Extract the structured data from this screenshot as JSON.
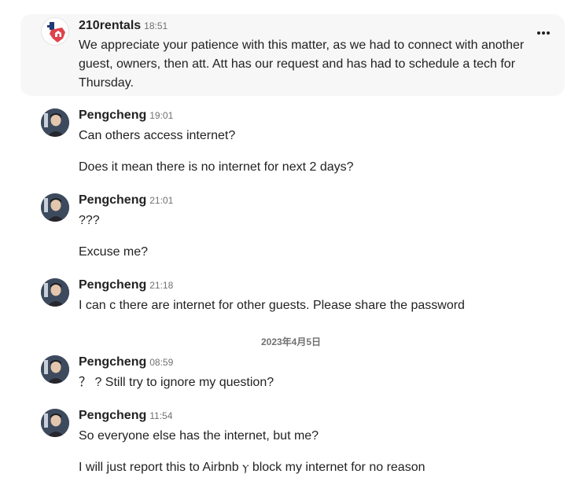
{
  "messages": [
    {
      "sender": "210rentals",
      "time": "18:51",
      "lines": [
        "We appreciate your patience with this matter, as we had to connect with another guest, owners, then att. Att has our request and has had to schedule a tech for Thursday."
      ]
    },
    {
      "sender": "Pengcheng",
      "time": "19:01",
      "lines": [
        "Can others access internet?",
        "Does it mean there is no internet for next 2 days?"
      ]
    },
    {
      "sender": "Pengcheng",
      "time": "21:01",
      "lines": [
        "???",
        "Excuse me?"
      ]
    },
    {
      "sender": "Pengcheng",
      "time": "21:18",
      "lines": [
        "I can c there are internet for other guests. Please share the password"
      ]
    },
    {
      "sender": "Pengcheng",
      "time": "08:59",
      "lines": [
        "？ ? Still try to ignore my question?"
      ]
    },
    {
      "sender": "Pengcheng",
      "time": "11:54",
      "lines": [
        "So everyone else has the internet, but me?",
        "I will just report this to Airbnb ⲩ block my internet for no reason"
      ]
    }
  ],
  "date_separator": "2023年4月5日",
  "icons": {
    "more": "more-options-icon",
    "host_avatar": "host-logo-icon",
    "user_avatar": "user-avatar"
  },
  "colors": {
    "highlight_bg": "#f7f7f7",
    "text": "#222222",
    "muted": "#717171",
    "host_brand_red": "#e0424b",
    "host_brand_blue": "#1f3b73"
  }
}
